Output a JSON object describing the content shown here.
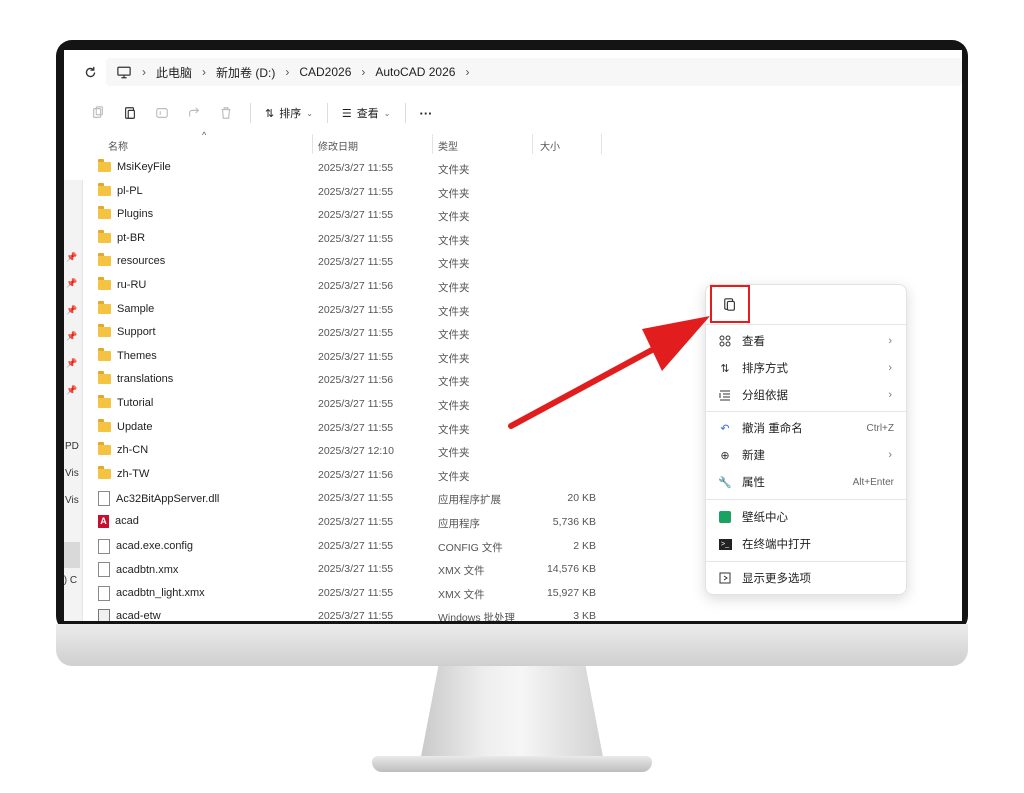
{
  "address": {
    "crumbs": [
      "此电脑",
      "新加卷 (D:)",
      "CAD2026",
      "AutoCAD 2026"
    ]
  },
  "toolbar": {
    "sort_label": "排序",
    "view_label": "查看",
    "more_label": "···"
  },
  "columns": {
    "name": "名称",
    "date": "修改日期",
    "type": "类型",
    "size": "大小"
  },
  "left_strip": [
    "PD",
    "Vis",
    "Vis",
    ":) C"
  ],
  "rows": [
    {
      "name": "MsiKeyFile",
      "date": "2025/3/27 11:55",
      "type": "文件夹",
      "size": "",
      "icon": "folder"
    },
    {
      "name": "pl-PL",
      "date": "2025/3/27 11:55",
      "type": "文件夹",
      "size": "",
      "icon": "folder"
    },
    {
      "name": "Plugins",
      "date": "2025/3/27 11:55",
      "type": "文件夹",
      "size": "",
      "icon": "folder"
    },
    {
      "name": "pt-BR",
      "date": "2025/3/27 11:55",
      "type": "文件夹",
      "size": "",
      "icon": "folder"
    },
    {
      "name": "resources",
      "date": "2025/3/27 11:55",
      "type": "文件夹",
      "size": "",
      "icon": "folder"
    },
    {
      "name": "ru-RU",
      "date": "2025/3/27 11:56",
      "type": "文件夹",
      "size": "",
      "icon": "folder"
    },
    {
      "name": "Sample",
      "date": "2025/3/27 11:55",
      "type": "文件夹",
      "size": "",
      "icon": "folder"
    },
    {
      "name": "Support",
      "date": "2025/3/27 11:55",
      "type": "文件夹",
      "size": "",
      "icon": "folder"
    },
    {
      "name": "Themes",
      "date": "2025/3/27 11:55",
      "type": "文件夹",
      "size": "",
      "icon": "folder"
    },
    {
      "name": "translations",
      "date": "2025/3/27 11:56",
      "type": "文件夹",
      "size": "",
      "icon": "folder"
    },
    {
      "name": "Tutorial",
      "date": "2025/3/27 11:55",
      "type": "文件夹",
      "size": "",
      "icon": "folder"
    },
    {
      "name": "Update",
      "date": "2025/3/27 11:55",
      "type": "文件夹",
      "size": "",
      "icon": "folder"
    },
    {
      "name": "zh-CN",
      "date": "2025/3/27 12:10",
      "type": "文件夹",
      "size": "",
      "icon": "folder"
    },
    {
      "name": "zh-TW",
      "date": "2025/3/27 11:56",
      "type": "文件夹",
      "size": "",
      "icon": "folder"
    },
    {
      "name": "Ac32BitAppServer.dll",
      "date": "2025/3/27 11:55",
      "type": "应用程序扩展",
      "size": "20 KB",
      "icon": "file"
    },
    {
      "name": "acad",
      "date": "2025/3/27 11:55",
      "type": "应用程序",
      "size": "5,736 KB",
      "icon": "app"
    },
    {
      "name": "acad.exe.config",
      "date": "2025/3/27 11:55",
      "type": "CONFIG 文件",
      "size": "2 KB",
      "icon": "file"
    },
    {
      "name": "acadbtn.xmx",
      "date": "2025/3/27 11:55",
      "type": "XMX 文件",
      "size": "14,576 KB",
      "icon": "file"
    },
    {
      "name": "acadbtn_light.xmx",
      "date": "2025/3/27 11:55",
      "type": "XMX 文件",
      "size": "15,927 KB",
      "icon": "file"
    },
    {
      "name": "acad-etw",
      "date": "2025/3/27 11:55",
      "type": "Windows 批处理",
      "size": "3 KB",
      "icon": "etw"
    }
  ],
  "context_menu": {
    "items": [
      {
        "label": "查看",
        "shortcut": "",
        "arrow": "›",
        "icon": "grid-icon"
      },
      {
        "label": "排序方式",
        "shortcut": "",
        "arrow": "›",
        "icon": "sort-icon"
      },
      {
        "label": "分组依据",
        "shortcut": "",
        "arrow": "›",
        "icon": "group-icon"
      },
      {
        "label": "撤消 重命名",
        "shortcut": "Ctrl+Z",
        "arrow": "",
        "icon": "undo-icon"
      },
      {
        "label": "新建",
        "shortcut": "",
        "arrow": "›",
        "icon": "new-icon"
      },
      {
        "label": "属性",
        "shortcut": "Alt+Enter",
        "arrow": "",
        "icon": "wrench-icon"
      },
      {
        "label": "壁纸中心",
        "shortcut": "",
        "arrow": "",
        "icon": "wallpaper-icon"
      },
      {
        "label": "在终端中打开",
        "shortcut": "",
        "arrow": "",
        "icon": "terminal-icon"
      },
      {
        "label": "显示更多选项",
        "shortcut": "",
        "arrow": "",
        "icon": "more-options-icon"
      }
    ]
  },
  "colors": {
    "highlight": "#e11d1d",
    "folder": "#f5c342"
  }
}
